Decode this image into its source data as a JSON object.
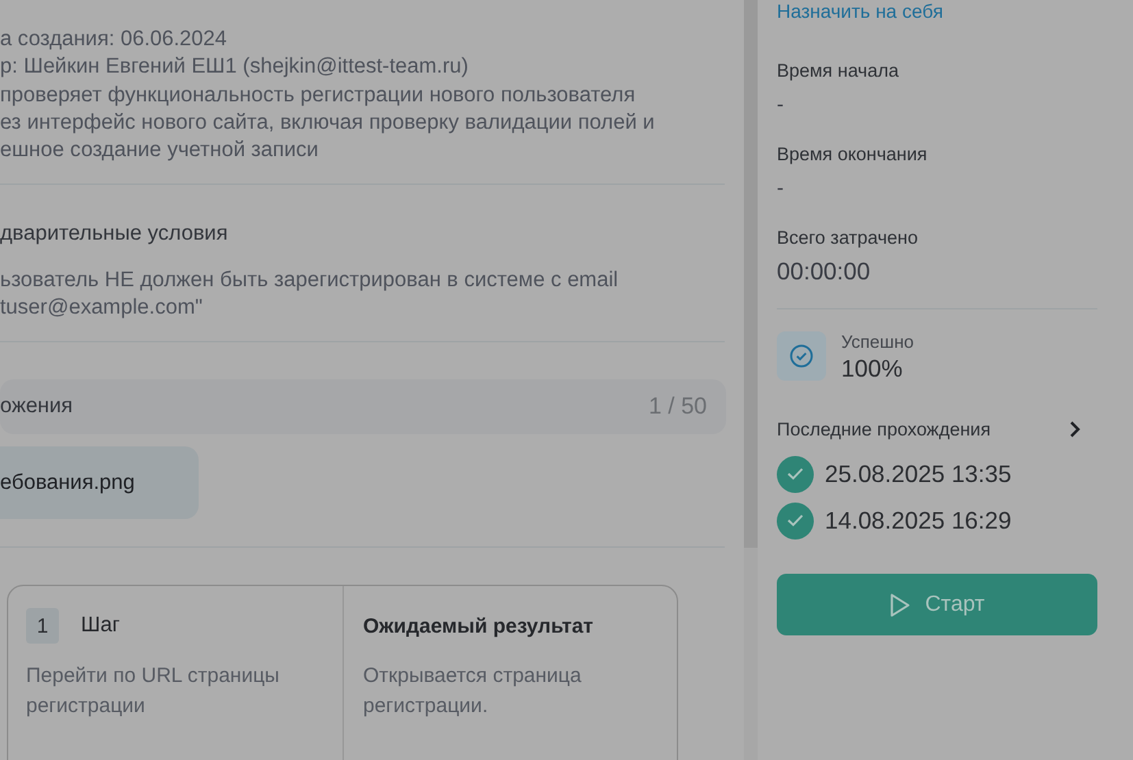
{
  "description": {
    "lines": [
      "а создания: 06.06.2024",
      "р: Шейкин Евгений ЕШ1 (shejkin@ittest-team.ru)",
      "проверяет функциональность регистрации нового пользователя",
      "ез интерфейс нового сайта, включая проверку валидации полей и",
      "ешное создание учетной записи"
    ]
  },
  "preconditions": {
    "title": "дварительные условия",
    "text": "ьзователь НЕ должен быть зарегистрирован в системе с email\ntuser@example.com\""
  },
  "attachments": {
    "title": "ожения",
    "count": "1 / 50",
    "files": [
      "ебования.png"
    ]
  },
  "steps": {
    "step_header": "Шаг",
    "expected_header": "Ожидаемый результат",
    "rows": [
      {
        "number": "1",
        "step": "Перейти по URL страницы регистрации",
        "expected": "Открывается страница регистрации."
      }
    ]
  },
  "sidebar": {
    "assign_link": "Назначить на себя",
    "fields": [
      {
        "label": "Время начала",
        "value": "-",
        "kind": "small"
      },
      {
        "label": "Время окончания",
        "value": "-",
        "kind": "small"
      },
      {
        "label": "Всего затрачено",
        "value": "00:00:00",
        "kind": "large"
      }
    ],
    "success": {
      "label": "Успешно",
      "value": "100%"
    },
    "recent_runs": {
      "title": "Последние прохождения",
      "items": [
        {
          "datetime": "25.08.2025 13:35",
          "passed": true
        },
        {
          "datetime": "14.08.2025 16:29",
          "passed": true
        }
      ]
    },
    "start_button": "Старт"
  }
}
